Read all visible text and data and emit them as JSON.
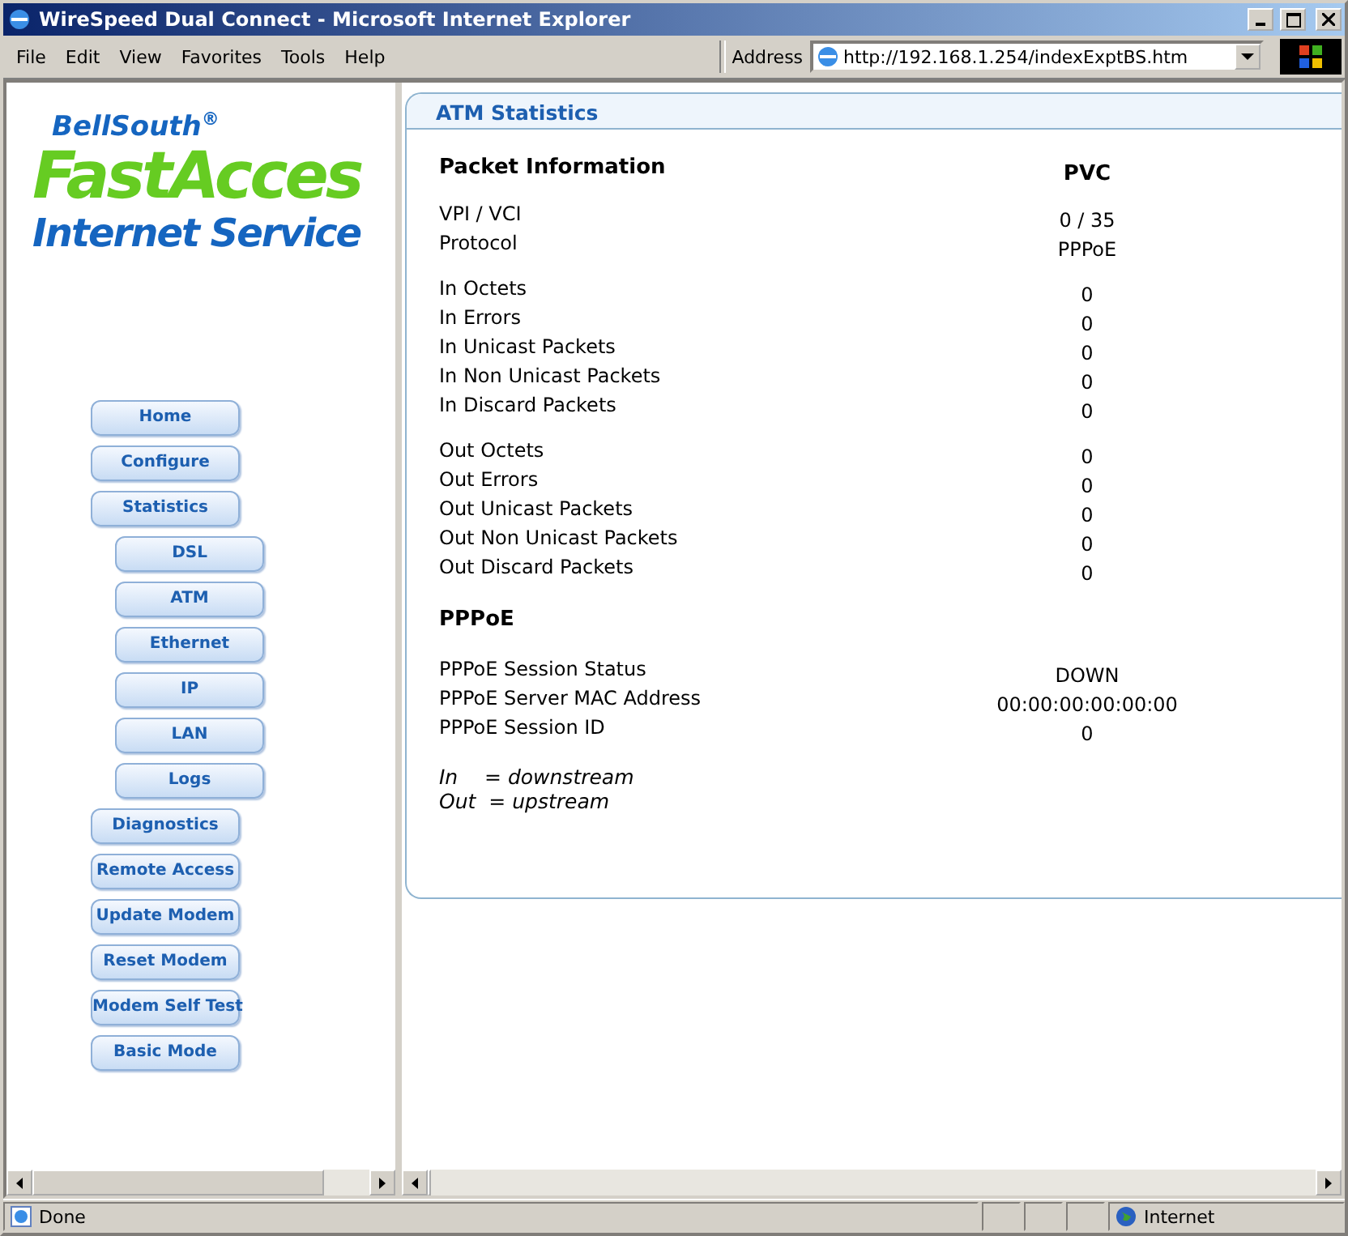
{
  "window": {
    "title": "WireSpeed Dual Connect - Microsoft Internet Explorer"
  },
  "menu": [
    "File",
    "Edit",
    "View",
    "Favorites",
    "Tools",
    "Help"
  ],
  "address": {
    "label": "Address",
    "value": "http://192.168.1.254/indexExptBS.htm"
  },
  "logo": {
    "brand": "BellSouth$^{®}$",
    "product": "FastAcces",
    "tagline": "Internet Service"
  },
  "nav": [
    {
      "label": "Home"
    },
    {
      "label": "Configure"
    },
    {
      "label": "Statistics",
      "children": [
        {
          "label": "DSL"
        },
        {
          "label": "ATM"
        },
        {
          "label": "Ethernet"
        },
        {
          "label": "IP"
        },
        {
          "label": "LAN"
        },
        {
          "label": "Logs"
        }
      ]
    },
    {
      "label": "Diagnostics"
    },
    {
      "label": "Remote Access"
    },
    {
      "label": "Update Modem"
    },
    {
      "label": "Reset Modem"
    },
    {
      "label": "Modem Self Test"
    },
    {
      "label": "Basic Mode"
    }
  ],
  "panel": {
    "title": "ATM Statistics",
    "heading": "Packet Information",
    "column": "PVC",
    "groups": [
      {
        "rows": [
          {
            "label": "VPI / VCI",
            "value": "0 / 35"
          },
          {
            "label": "Protocol",
            "value": "PPPoE"
          }
        ]
      },
      {
        "rows": [
          {
            "label": "In Octets",
            "value": "0"
          },
          {
            "label": "In Errors",
            "value": "0"
          },
          {
            "label": "In Unicast Packets",
            "value": "0"
          },
          {
            "label": "In Non Unicast Packets",
            "value": "0"
          },
          {
            "label": "In Discard Packets",
            "value": "0"
          }
        ]
      },
      {
        "rows": [
          {
            "label": "Out Octets",
            "value": "0"
          },
          {
            "label": "Out Errors",
            "value": "0"
          },
          {
            "label": "Out Unicast Packets",
            "value": "0"
          },
          {
            "label": "Out Non Unicast Packets",
            "value": "0"
          },
          {
            "label": "Out Discard Packets",
            "value": "0"
          }
        ]
      }
    ],
    "section": "PPPoE",
    "pppoe": [
      {
        "label": "PPPoE Session Status",
        "value": "DOWN"
      },
      {
        "label": "PPPoE Server MAC Address",
        "value": "00:00:00:00:00:00"
      },
      {
        "label": "PPPoE Session ID",
        "value": "0"
      }
    ],
    "legend": [
      {
        "term": "In",
        "meaning": "= downstream"
      },
      {
        "term": "Out",
        "meaning": "= upstream"
      }
    ]
  },
  "status_bar": {
    "text": "Done",
    "zone": "Internet"
  }
}
